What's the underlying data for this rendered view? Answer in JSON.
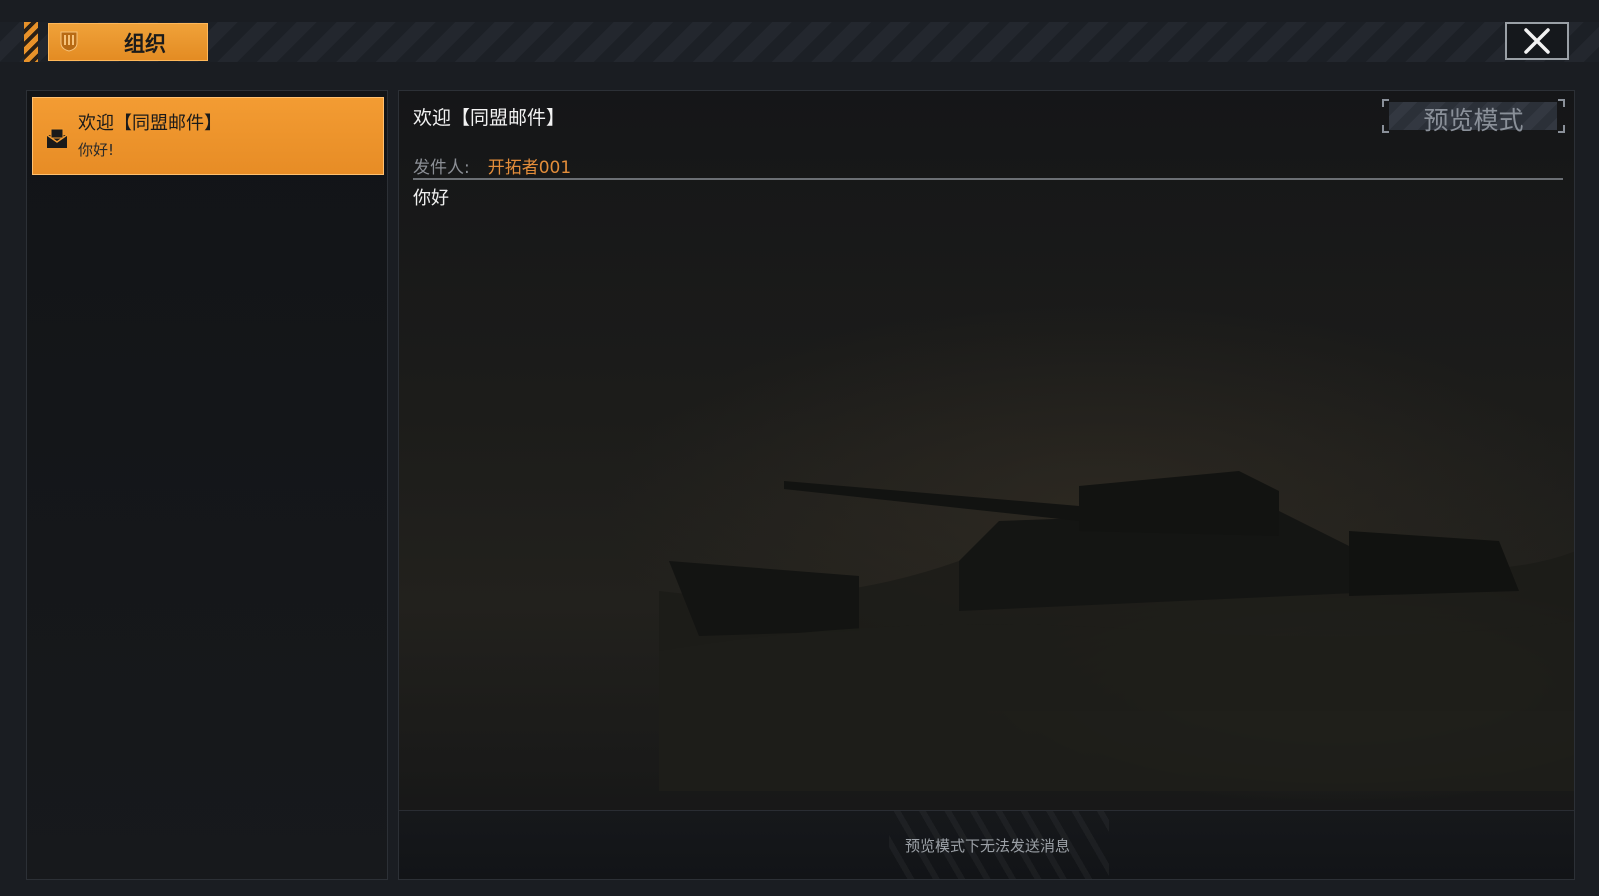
{
  "header": {
    "tab_label": "组织",
    "close_icon": "close-icon",
    "accent_color": "#e8922a"
  },
  "mail_list": {
    "items": [
      {
        "title": "欢迎【同盟邮件】",
        "preview": "你好!",
        "icon": "mail-icon",
        "selected": true
      }
    ]
  },
  "mail_view": {
    "title": "欢迎【同盟邮件】",
    "preview_mode_label": "预览模式",
    "sender_label": "发件人:",
    "sender_name": "开拓者001",
    "body": "你好",
    "footer_note": "预览模式下无法发送消息"
  }
}
